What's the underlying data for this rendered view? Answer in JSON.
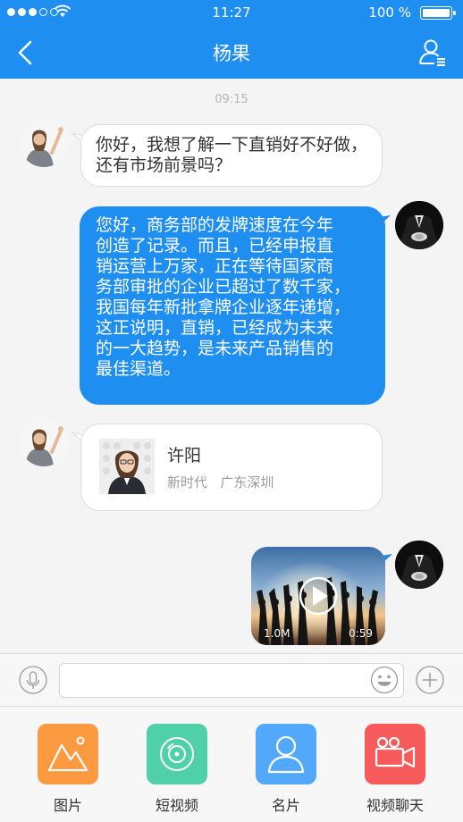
{
  "status_bar": {
    "time": "11:27",
    "battery": "100 %",
    "signal_dots_filled": 3,
    "signal_dots_total": 5
  },
  "nav": {
    "title": "杨果",
    "back_icon": "chevron-left-icon",
    "profile_icon": "contact-list-icon",
    "color": "#1e8ef1"
  },
  "chat": {
    "timestamp": "09:15",
    "messages": [
      {
        "side": "in",
        "text_lines": [
          "你好，我想了解一下直销好不好做，",
          "还有市场前景吗？"
        ]
      },
      {
        "side": "out",
        "text_lines": [
          "您好，商务部的发牌速度在今年",
          "创造了记录。而且，已经申报直",
          "销运营上万家，正在等待国家商",
          "务部审批的企业已超过了数千家，",
          "我国每年新批拿牌企业逐年递增，",
          "这正说明，直销，已经成为未来",
          "的一大趋势，是未来产品销售的",
          "最佳渠道。"
        ]
      },
      {
        "side": "in",
        "type": "card",
        "name": "许阳",
        "company": "新时代",
        "location": "广东深圳"
      },
      {
        "side": "out",
        "type": "video",
        "size": "1.0M",
        "duration": "0:59"
      }
    ]
  },
  "input": {
    "placeholder": "",
    "value": ""
  },
  "toolbar": {
    "items": [
      {
        "label": "图片",
        "icon": "image-icon",
        "color": "#fb9a41"
      },
      {
        "label": "短视频",
        "icon": "short-video-icon",
        "color": "#4fd0a7"
      },
      {
        "label": "名片",
        "icon": "contact-card-icon",
        "color": "#52a9fb"
      },
      {
        "label": "视频聊天",
        "icon": "video-camera-icon",
        "color": "#f65a5a"
      }
    ]
  }
}
